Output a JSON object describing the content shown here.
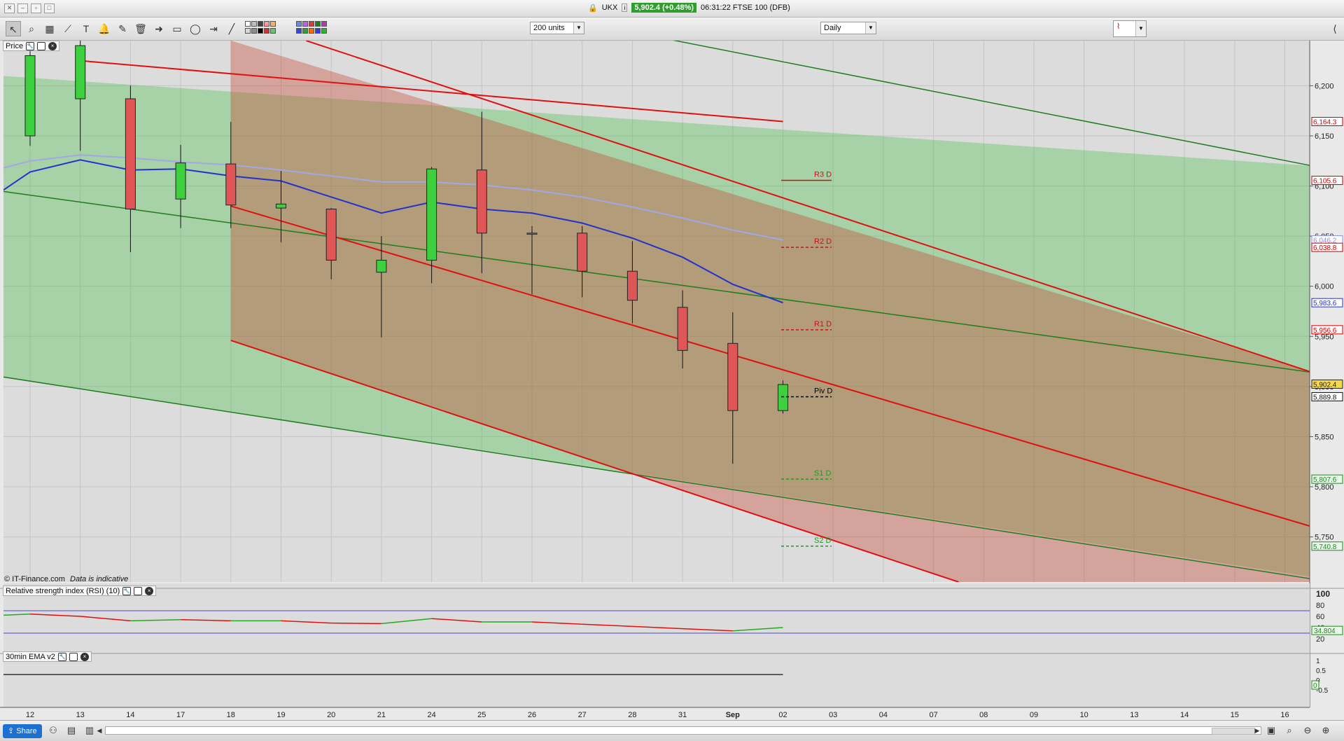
{
  "window": {
    "instrument": "UKX",
    "price_chip": "5,902.4 (+0.48%)",
    "time_title": "06:31:22 FTSE 100 (DFB)"
  },
  "toolbar": {
    "units_select": "200 units",
    "period_select": "Daily"
  },
  "panes": {
    "price_label": "Price",
    "rsi_label": "Relative strength index (RSI) (10)",
    "ema_label": "30min EMA v2",
    "watermark": "© IT-Finance.com",
    "indicative": "Data is indicative"
  },
  "colors": {
    "up": "#3ecf3e",
    "down": "#e05555",
    "green_channel": "#1e7d1e",
    "red_line": "#e01010",
    "ema_blue": "#2233cc",
    "ema_light": "#a0a8e6",
    "pivot_red": "#cc1111",
    "pivot_green": "#229922"
  },
  "price_axis": {
    "ticks": [
      "6,200",
      "6,150",
      "6,100",
      "6,050",
      "6,000",
      "5,950",
      "5,900",
      "5,850",
      "5,800",
      "5,750"
    ],
    "tags": [
      {
        "text": "6,164.3",
        "value": 6164.3,
        "kind": "red"
      },
      {
        "text": "6,105.6",
        "value": 6105.6,
        "kind": "red"
      },
      {
        "text": "6,046.2",
        "value": 6046.2,
        "kind": "lav"
      },
      {
        "text": "6,038.8",
        "value": 6038.8,
        "kind": "red"
      },
      {
        "text": "5,983.6",
        "value": 5983.6,
        "kind": "blue"
      },
      {
        "text": "5,956.6",
        "value": 5956.6,
        "kind": "red"
      },
      {
        "text": "5,902.4",
        "value": 5902.4,
        "kind": "yellow"
      },
      {
        "text": "5,889.8",
        "value": 5889.8,
        "kind": "black"
      },
      {
        "text": "5,807.6",
        "value": 5807.6,
        "kind": "green"
      },
      {
        "text": "5,740.8",
        "value": 5740.8,
        "kind": "green"
      }
    ]
  },
  "pivots": [
    {
      "label": "R3 D",
      "value": 6105.6,
      "style": "solid",
      "color": "#cc1111"
    },
    {
      "label": "R2 D",
      "value": 6038.8,
      "style": "dashed",
      "color": "#cc1111"
    },
    {
      "label": "R1 D",
      "value": 5956.6,
      "style": "dashed",
      "color": "#cc1111"
    },
    {
      "label": "Piv D",
      "value": 5889.8,
      "style": "dashed",
      "color": "#000000"
    },
    {
      "label": "S1 D",
      "value": 5807.6,
      "style": "dashed",
      "color": "#229922"
    },
    {
      "label": "S2 D",
      "value": 5740.8,
      "style": "dashed",
      "color": "#229922"
    }
  ],
  "rsi_axis": {
    "ticks": [
      "100",
      "80",
      "60",
      "40",
      "20"
    ],
    "value_tag": "34.804"
  },
  "ema_axis": {
    "ticks": [
      "1",
      "0.5",
      "0",
      "-0.5"
    ],
    "value_tag": "0"
  },
  "x_axis_labels": [
    "12",
    "13",
    "14",
    "17",
    "18",
    "19",
    "20",
    "21",
    "24",
    "25",
    "26",
    "27",
    "28",
    "31",
    "Sep",
    "02",
    "03",
    "04",
    "07",
    "08",
    "09",
    "10",
    "13",
    "14",
    "15",
    "16"
  ],
  "chart_data": {
    "type": "candlestick",
    "categories": [
      "12",
      "13",
      "14",
      "17",
      "18",
      "19",
      "20",
      "21",
      "24",
      "25",
      "26",
      "27",
      "28",
      "31",
      "Sep",
      "02"
    ],
    "candles": [
      {
        "o": 6150,
        "h": 6235,
        "l": 6140,
        "c": 6230
      },
      {
        "o": 6187,
        "h": 6245,
        "l": 6135,
        "c": 6240
      },
      {
        "o": 6187,
        "h": 6200,
        "l": 6034,
        "c": 6077
      },
      {
        "o": 6087,
        "h": 6141,
        "l": 6058,
        "c": 6123
      },
      {
        "o": 6122,
        "h": 6164,
        "l": 6058,
        "c": 6081
      },
      {
        "o": 6078,
        "h": 6115,
        "l": 6044,
        "c": 6082
      },
      {
        "o": 6077,
        "h": 6078,
        "l": 6007,
        "c": 6026
      },
      {
        "o": 6014,
        "h": 6050,
        "l": 5949,
        "c": 6026
      },
      {
        "o": 6026,
        "h": 6119,
        "l": 6003,
        "c": 6117
      },
      {
        "o": 6116,
        "h": 6174,
        "l": 6013,
        "c": 6053
      },
      {
        "o": 6053,
        "h": 6060,
        "l": 5992,
        "c": 6053
      },
      {
        "o": 6053,
        "h": 6060,
        "l": 5989,
        "c": 6015
      },
      {
        "o": 6015,
        "h": 6045,
        "l": 5963,
        "c": 5986
      },
      {
        "o": 5979,
        "h": 5996,
        "l": 5918,
        "c": 5936
      },
      {
        "o": 5943,
        "h": 5974,
        "l": 5823,
        "c": 5876
      },
      {
        "o": 5876,
        "h": 5906,
        "l": 5873,
        "c": 5902
      }
    ],
    "ema_fast": [
      6096,
      6114,
      6126,
      6116,
      6117,
      6110,
      6105,
      6089,
      6073,
      6084,
      6077,
      6073,
      6063,
      6048,
      6029,
      6002,
      5983.6
    ],
    "ema_slow": [
      6118,
      6125,
      6131,
      6128,
      6124,
      6121,
      6116,
      6110,
      6104,
      6104,
      6101,
      6096,
      6089,
      6079,
      6068,
      6056,
      6046.2
    ],
    "rsi": [
      62,
      64,
      60,
      52,
      54,
      52,
      52,
      48,
      47,
      56,
      50,
      50,
      46,
      42,
      38,
      34,
      40
    ],
    "y_range": [
      5705,
      6245
    ],
    "rsi_range": [
      0,
      100
    ],
    "ema_osc": [
      0,
      0,
      0,
      0,
      0,
      0,
      0,
      0,
      0,
      0,
      0,
      0,
      0,
      0,
      0,
      0,
      0
    ]
  },
  "bottombar": {
    "share_label": "Share"
  }
}
